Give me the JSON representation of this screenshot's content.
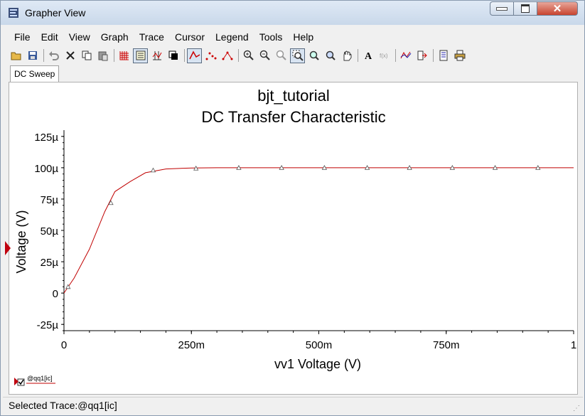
{
  "window": {
    "title": "Grapher View"
  },
  "menus": [
    "File",
    "Edit",
    "View",
    "Graph",
    "Trace",
    "Cursor",
    "Legend",
    "Tools",
    "Help"
  ],
  "toolbar": {
    "icons": [
      "open-icon",
      "save-icon",
      "undo-icon",
      "delete-icon",
      "copy-icon",
      "paste-icon",
      "grid-icon",
      "legend-icon",
      "cursors-icon",
      "overlay-icon",
      "line-trace-icon",
      "points-trace-icon",
      "line-points-trace-icon",
      "zoom-in-icon",
      "zoom-out-icon",
      "zoom-reset-icon",
      "zoom-area-icon",
      "zoom-x-icon",
      "zoom-y-icon",
      "pan-hand-icon",
      "text-icon",
      "expression-icon",
      "add-trace-icon",
      "export-icon",
      "page-setup-icon",
      "print-icon"
    ]
  },
  "tabs": [
    {
      "label": "DC Sweep"
    }
  ],
  "colors": {
    "trace": "#c00000",
    "axis": "#000000",
    "accent": "#c0000e"
  },
  "chart_data": {
    "type": "line",
    "title": "bjt_tutorial",
    "subtitle": "DC Transfer Characteristic",
    "xlabel": "vv1 Voltage (V)",
    "ylabel": "Voltage (V)",
    "xlim": [
      0,
      1
    ],
    "ylim": [
      -3e-05,
      0.00013
    ],
    "x_ticks": [
      0,
      0.25,
      0.5,
      0.75,
      1
    ],
    "x_tick_labels": [
      "0",
      "250m",
      "500m",
      "750m",
      "1"
    ],
    "y_ticks": [
      -2.5e-05,
      0,
      2.5e-05,
      5e-05,
      7.5e-05,
      0.0001,
      0.000125
    ],
    "y_tick_labels": [
      "-25µ",
      "0",
      "25µ",
      "50µ",
      "75µ",
      "100µ",
      "125µ"
    ],
    "grid": false,
    "legend": "bottom-left",
    "series": [
      {
        "name": "@qq1[ic]",
        "x": [
          0,
          0.02,
          0.05,
          0.08,
          0.1,
          0.13,
          0.16,
          0.2,
          0.25,
          0.3,
          0.4,
          0.5,
          0.6,
          0.7,
          0.8,
          0.9,
          1.0
        ],
        "y": [
          0,
          1.2e-05,
          3.5e-05,
          6.5e-05,
          8.1e-05,
          8.9e-05,
          9.6e-05,
          9.9e-05,
          9.98e-05,
          0.0001,
          0.0001,
          0.0001,
          0.0001,
          0.0001,
          0.0001,
          0.0001,
          0.0001
        ],
        "marker_x": [
          0.008,
          0.092,
          0.175,
          0.259,
          0.343,
          0.427,
          0.511,
          0.595,
          0.678,
          0.762,
          0.846,
          0.93
        ],
        "marker_y": [
          5e-06,
          7.2e-05,
          9.8e-05,
          9.95e-05,
          0.0001,
          0.0001,
          0.0001,
          0.0001,
          0.0001,
          0.0001,
          0.0001,
          0.0001
        ]
      }
    ]
  },
  "legend": {
    "checked": true
  },
  "status": {
    "text": "Selected Trace:@qq1[ic]"
  }
}
